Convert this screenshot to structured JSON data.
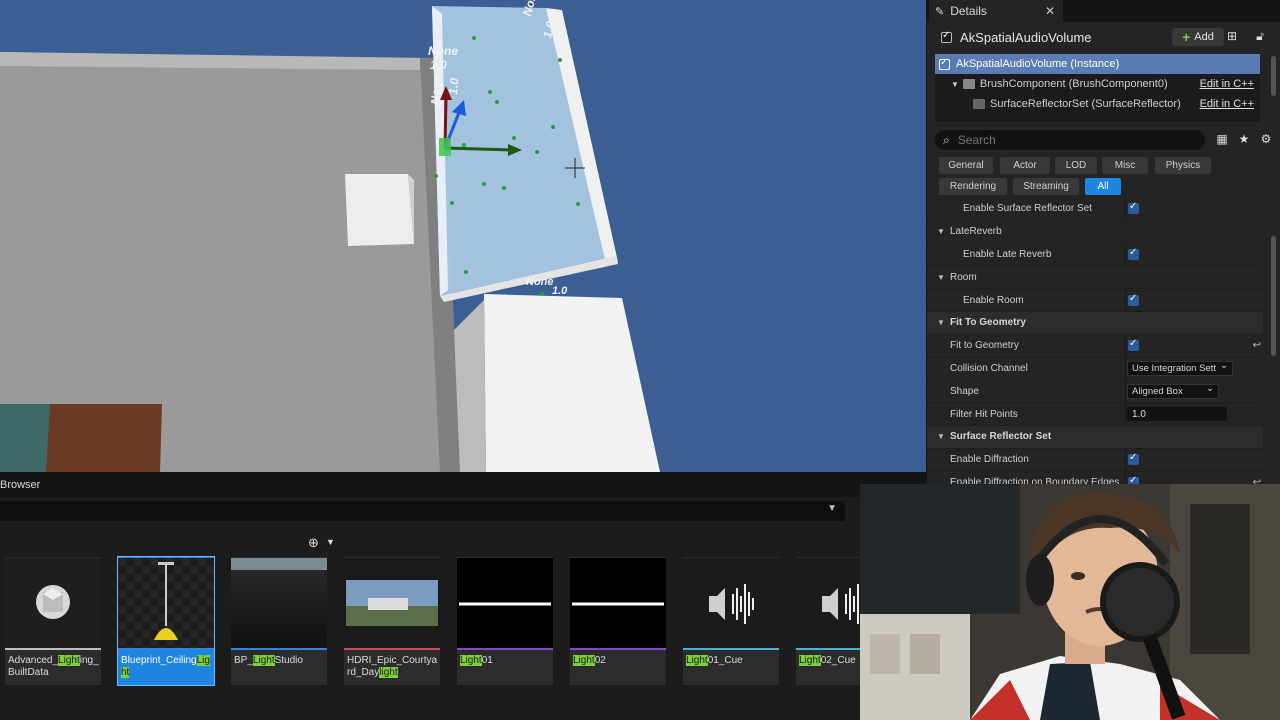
{
  "viewport": {
    "labels": [
      "None",
      "1.0",
      "None",
      "1.0",
      "None",
      "1.0",
      "None",
      "1.0"
    ]
  },
  "details": {
    "tab_label": "Details",
    "title": "AkSpatialAudioVolume",
    "add_label": "Add",
    "components": [
      {
        "label": "AkSpatialAudioVolume (Instance)",
        "edit": ""
      },
      {
        "label": "BrushComponent (BrushComponent0)",
        "edit": "Edit in C++"
      },
      {
        "label": "SurfaceReflectorSet (SurfaceReflector)",
        "edit": "Edit in C++"
      }
    ],
    "search_placeholder": "Search",
    "filters": [
      "General",
      "Actor",
      "LOD",
      "Misc",
      "Physics",
      "Rendering",
      "Streaming",
      "All"
    ],
    "active_filter": "All",
    "rows": [
      {
        "type": "prop",
        "label": "Enable Surface Reflector Set",
        "indent": 2,
        "value": "check"
      },
      {
        "type": "subcat",
        "label": "LateReverb"
      },
      {
        "type": "prop",
        "label": "Enable Late Reverb",
        "indent": 2,
        "value": "check"
      },
      {
        "type": "subcat",
        "label": "Room"
      },
      {
        "type": "prop",
        "label": "Enable Room",
        "indent": 2,
        "value": "check"
      },
      {
        "type": "cat",
        "label": "Fit To Geometry"
      },
      {
        "type": "prop",
        "label": "Fit to Geometry",
        "indent": 1,
        "value": "check",
        "reset": true
      },
      {
        "type": "prop",
        "label": "Collision Channel",
        "indent": 1,
        "value": "dropdown",
        "text": "Use Integration Sett"
      },
      {
        "type": "prop",
        "label": "Shape",
        "indent": 1,
        "value": "dropdown",
        "text": "Aligned Box"
      },
      {
        "type": "prop",
        "label": "Filter Hit Points",
        "indent": 1,
        "value": "number",
        "text": "1.0"
      },
      {
        "type": "cat",
        "label": "Surface Reflector Set"
      },
      {
        "type": "prop",
        "label": "Enable Diffraction",
        "indent": 1,
        "value": "check"
      },
      {
        "type": "prop",
        "label": "Enable Diffraction on Boundary Edges",
        "indent": 1,
        "value": "check",
        "reset": true
      }
    ]
  },
  "browser": {
    "title": "Browser",
    "assets": [
      {
        "pre": "Advanced_",
        "hl": "Light",
        "post": "ing_BuiltData",
        "strip": "#bdbdbd",
        "kind": "sphere"
      },
      {
        "pre": "Blueprint_Ceiling",
        "hl": "Light",
        "post": "",
        "strip": "#2f84e6",
        "kind": "lamp",
        "selected": true
      },
      {
        "pre": "BP_",
        "hl": "Light",
        "post": "Studio",
        "strip": "#2f84e6",
        "kind": "studio"
      },
      {
        "pre": "HDRI_Epic_Courtyard_Day",
        "hl": "light",
        "post": "",
        "strip": "#d24a5a",
        "kind": "hdri"
      },
      {
        "pre": "",
        "hl": "Light",
        "post": "01",
        "strip": "#8a44d6",
        "kind": "wave"
      },
      {
        "pre": "",
        "hl": "Light",
        "post": "02",
        "strip": "#8a44d6",
        "kind": "wave"
      },
      {
        "pre": "",
        "hl": "Light",
        "post": "01_Cue",
        "strip": "#3fb6d8",
        "kind": "cue"
      },
      {
        "pre": "",
        "hl": "Light",
        "post": "02_Cue",
        "strip": "#3fb6d8",
        "kind": "cue"
      }
    ]
  },
  "colors": {
    "accent": "#1e86e0",
    "highlight": "#7cd03a",
    "panel": "#242424",
    "sky": "#3b5f93"
  }
}
